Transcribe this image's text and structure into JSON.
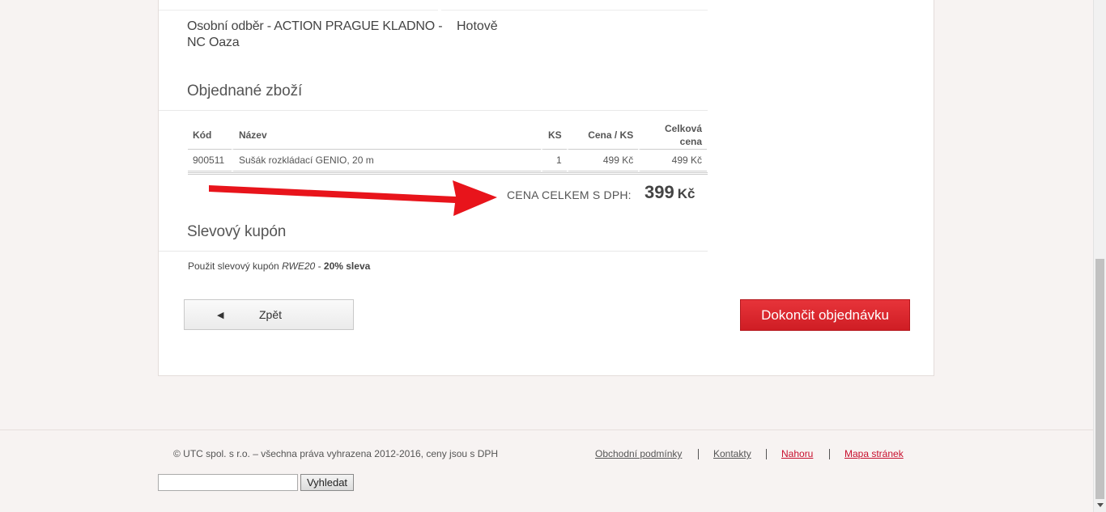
{
  "shipping": {
    "method": "Osobní odběr - ACTION PRAGUE KLADNO - NC Oaza",
    "payment": "Hotově"
  },
  "ordered_goods": {
    "title": "Objednané zboží",
    "columns": {
      "code": "Kód",
      "name": "Název",
      "qty": "KS",
      "unit_price": "Cena / KS",
      "total_price": "Celková cena"
    },
    "rows": [
      {
        "code": "900511",
        "name": "Sušák rozkládací GENIO, 20 m",
        "qty": "1",
        "unit_price": "499 Kč",
        "total_price": "499 Kč"
      }
    ],
    "total_label": "CENA CELKEM S DPH:",
    "total_amount": "399",
    "total_currency": "Kč"
  },
  "coupon": {
    "title": "Slevový kupón",
    "prefix": "Použit slevový kupón",
    "code": "RWE20",
    "dash": "-",
    "discount": "20% sleva"
  },
  "buttons": {
    "back_icon": "left-triangle-icon",
    "back_label": "Zpět",
    "finish_label": "Dokončit objednávku"
  },
  "footer": {
    "copyright": "© UTC spol. s r.o. – všechna práva vyhrazena 2012-2016, ceny jsou s DPH",
    "links": [
      "Obchodní podmínky",
      "Kontakty",
      "Nahoru",
      "Mapa stránek"
    ],
    "search_value": "",
    "search_button": "Vyhledat"
  },
  "annotation": {
    "icon": "red-arrow-icon",
    "color": "#e8141b"
  },
  "colors": {
    "accent": "#d9232a",
    "link_gray": "#555555",
    "link_red": "#c8102e",
    "background": "#f7f3f2"
  }
}
